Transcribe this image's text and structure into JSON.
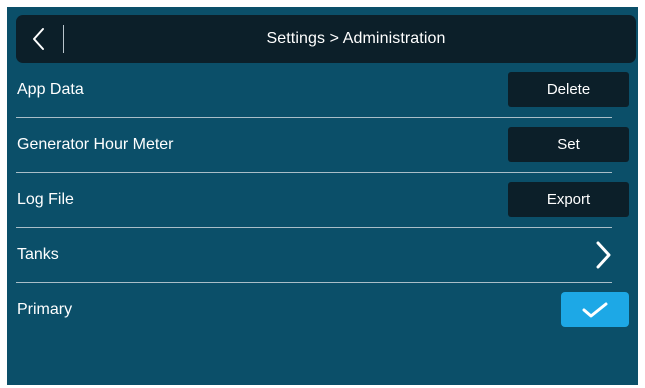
{
  "header": {
    "title": "Settings > Administration",
    "back_icon": "chevron-left-icon"
  },
  "rows": [
    {
      "label": "App Data",
      "action": {
        "type": "button",
        "label": "Delete"
      }
    },
    {
      "label": "Generator Hour Meter",
      "action": {
        "type": "button",
        "label": "Set"
      }
    },
    {
      "label": "Log File",
      "action": {
        "type": "button",
        "label": "Export"
      }
    },
    {
      "label": "Tanks",
      "action": {
        "type": "navigate",
        "icon": "chevron-right-icon"
      }
    },
    {
      "label": "Primary",
      "action": {
        "type": "checkbox",
        "checked": true,
        "icon": "checkmark-icon"
      }
    }
  ],
  "colors": {
    "background": "#0b4f69",
    "header": "#0c1f29",
    "button": "#0c1f29",
    "accent": "#1da8e6",
    "text": "#ffffff",
    "separator": "#a9bec8"
  }
}
